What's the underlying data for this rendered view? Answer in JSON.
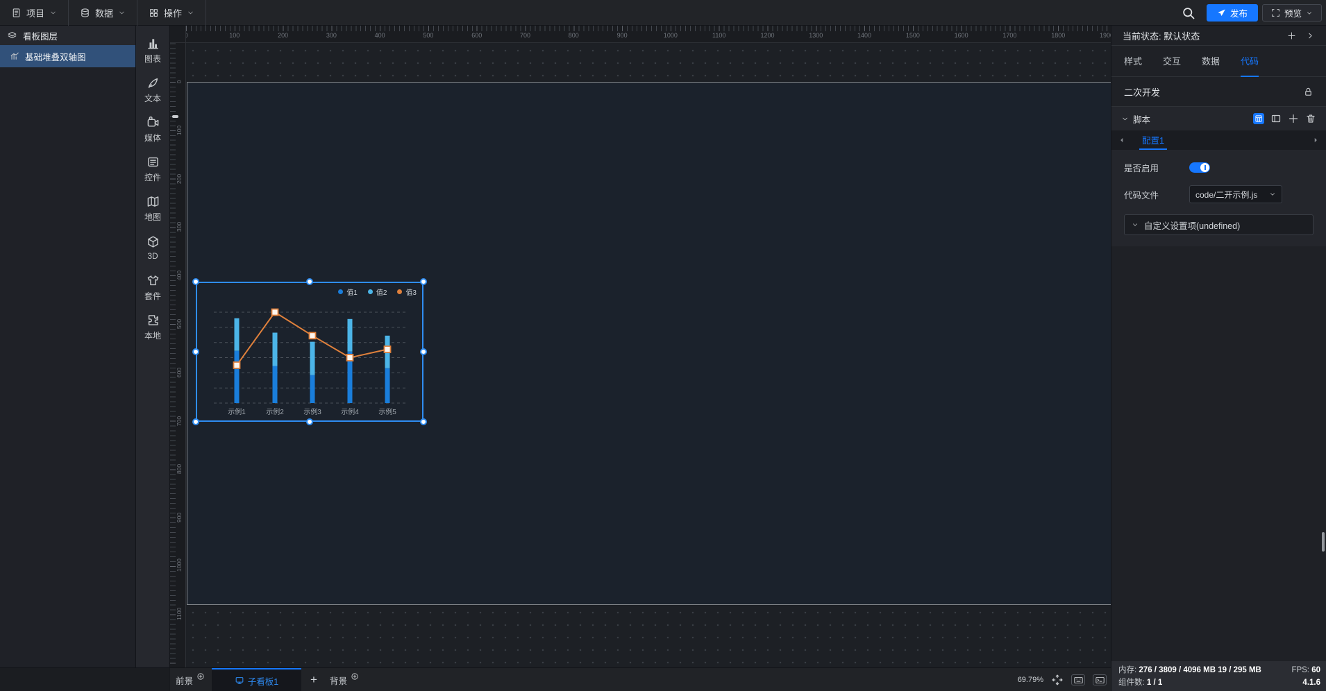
{
  "topbar": {
    "menus": [
      {
        "label": "项目"
      },
      {
        "label": "数据"
      },
      {
        "label": "操作"
      }
    ],
    "publish_label": "发布",
    "preview_label": "预览"
  },
  "layers_panel": {
    "title": "看板图层",
    "items": [
      {
        "label": "基础堆叠双轴图",
        "selected": true
      }
    ]
  },
  "toolbox": {
    "items": [
      {
        "label": "图表",
        "icon": "chart"
      },
      {
        "label": "文本",
        "icon": "text"
      },
      {
        "label": "媒体",
        "icon": "media"
      },
      {
        "label": "控件",
        "icon": "widget"
      },
      {
        "label": "地图",
        "icon": "map"
      },
      {
        "label": "3D",
        "icon": "cube"
      },
      {
        "label": "套件",
        "icon": "kit"
      },
      {
        "label": "本地",
        "icon": "local"
      }
    ]
  },
  "canvas": {
    "ruler_h_labels": [
      "0",
      "100",
      "200",
      "300",
      "400",
      "500",
      "600",
      "700",
      "800",
      "900",
      "1000",
      "1100",
      "1200",
      "1300",
      "1400",
      "1500",
      "1600",
      "1700",
      "1800",
      "1900"
    ],
    "ruler_v_labels": [
      "0",
      "100",
      "200",
      "300",
      "400",
      "500",
      "600",
      "700",
      "800",
      "900",
      "1000",
      "1100"
    ]
  },
  "chart_data": {
    "type": "bar",
    "subtype": "stacked bars + line (dual axis)",
    "categories": [
      "示例1",
      "示例2",
      "示例3",
      "示例4",
      "示例5"
    ],
    "series": [
      {
        "name": "值1",
        "type": "bar",
        "stack": "total",
        "color": "#1a7edb",
        "values": [
          69,
          49,
          37,
          68,
          46
        ]
      },
      {
        "name": "值2",
        "type": "bar",
        "stack": "total",
        "color": "#4cb5e8",
        "values": [
          43,
          44,
          44,
          43,
          43
        ]
      },
      {
        "name": "值3",
        "type": "line",
        "color": "#e0813c",
        "values": [
          50,
          120,
          89,
          60,
          71
        ]
      }
    ],
    "title": "",
    "xlabel": "",
    "ylabel": "",
    "ylim": [
      0,
      120
    ],
    "grid": "dashed horizontal, 7 lines (every 20 units)",
    "legend_position": "top-right",
    "note": "axis value labels not visible; values estimated from gridlines"
  },
  "inspector": {
    "state_label": "当前状态:",
    "state_value": "默认状态",
    "tabs": [
      {
        "label": "样式"
      },
      {
        "label": "交互"
      },
      {
        "label": "数据"
      },
      {
        "label": "代码",
        "active": true
      }
    ],
    "section_title": "二次开发",
    "script": {
      "title": "脚本",
      "config_tab": "配置1",
      "enable_label": "是否启用",
      "enabled": true,
      "file_label": "代码文件",
      "file_value": "code/二开示例.js",
      "custom_settings_label": "自定义设置项(undefined)"
    }
  },
  "bottombar": {
    "foreground_label": "前景",
    "board_tab_label": "子看板1",
    "add_label": "+",
    "background_label": "背景",
    "zoom_value": "69.79%"
  },
  "statusbar": {
    "memory_label": "内存:",
    "memory_value": "276 / 3809 / 4096 MB",
    "memory_extra": "19 / 295 MB",
    "fps_label": "FPS:",
    "fps_value": "60",
    "components_label": "组件数:",
    "components_value": "1 / 1",
    "version": "4.1.6"
  }
}
